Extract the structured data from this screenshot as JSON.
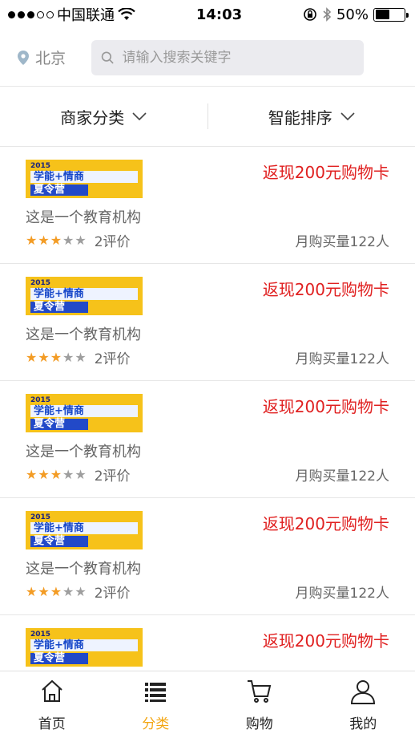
{
  "status_bar": {
    "carrier": "中国联通",
    "time": "14:03",
    "battery": "50%",
    "battery_level": 0.5,
    "signal_bars_filled": 3,
    "signal_bars_total": 5
  },
  "header": {
    "city": "北京",
    "search_placeholder": "请输入搜索关键字"
  },
  "filters": {
    "category_label": "商家分类",
    "sort_label": "智能排序"
  },
  "items": [
    {
      "image_line1": "2015 ",
      "image_line2": "学能+情商",
      "image_line3": "夏令营",
      "promo": "返现200元购物卡",
      "desc": "这是一个教育机构",
      "rating": 3,
      "rating_max": 5,
      "reviews": "2评价",
      "sales": "月购买量122人"
    },
    {
      "image_line1": "2015 ",
      "image_line2": "学能+情商",
      "image_line3": "夏令营",
      "promo": "返现200元购物卡",
      "desc": "这是一个教育机构",
      "rating": 3,
      "rating_max": 5,
      "reviews": "2评价",
      "sales": "月购买量122人"
    },
    {
      "image_line1": "2015 ",
      "image_line2": "学能+情商",
      "image_line3": "夏令营",
      "promo": "返现200元购物卡",
      "desc": "这是一个教育机构",
      "rating": 3,
      "rating_max": 5,
      "reviews": "2评价",
      "sales": "月购买量122人"
    },
    {
      "image_line1": "2015 ",
      "image_line2": "学能+情商",
      "image_line3": "夏令营",
      "promo": "返现200元购物卡",
      "desc": "这是一个教育机构",
      "rating": 3,
      "rating_max": 5,
      "reviews": "2评价",
      "sales": "月购买量122人"
    },
    {
      "image_line1": "2015 ",
      "image_line2": "学能+情商",
      "image_line3": "夏令营",
      "promo": "返现200元购物卡",
      "desc": "",
      "rating": 0,
      "rating_max": 5,
      "reviews": "",
      "sales": ""
    }
  ],
  "tabbar": {
    "tabs": [
      {
        "label": "首页",
        "icon": "home-icon",
        "active": false
      },
      {
        "label": "分类",
        "icon": "list-icon",
        "active": true
      },
      {
        "label": "购物",
        "icon": "cart-icon",
        "active": false
      },
      {
        "label": "我的",
        "icon": "user-icon",
        "active": false
      }
    ]
  },
  "colors": {
    "accent": "#f3a613",
    "promo": "#e02020",
    "star_on": "#f39c25",
    "star_off": "#9e9e9e"
  }
}
